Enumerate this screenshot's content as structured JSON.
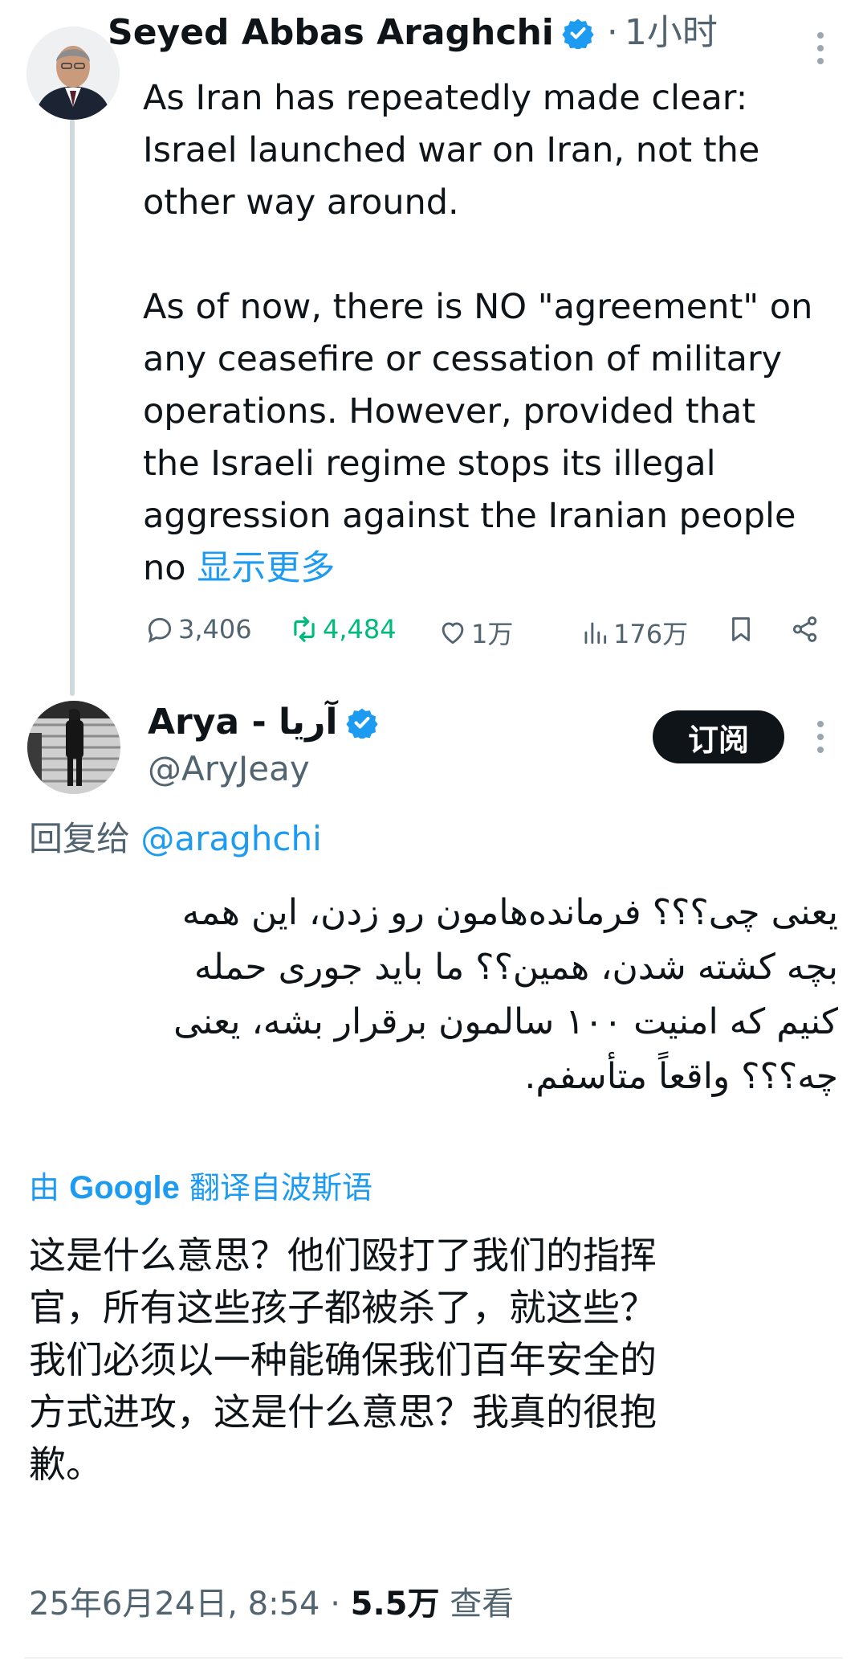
{
  "tweet1": {
    "author_name": "Seyed Abbas Araghchi",
    "time_sep": "·",
    "time": "1小时",
    "text": "As Iran has repeatedly made clear:\nIsrael launched war on Iran, not the\nother way around.\n\nAs of now, there is NO \"agreement\" on\nany ceasefire or cessation of military\noperations. However, provided that\nthe Israeli regime stops its illegal\naggression against the Iranian people\nno ",
    "show_more": "显示更多",
    "replies": "3,406",
    "retweets": "4,484",
    "likes": "1万",
    "views": "176万"
  },
  "tweet2": {
    "author_name": "Arya - آریا",
    "handle": "@AryJeay",
    "subscribe_label": "订阅",
    "reply_to_prefix": "回复给 ",
    "reply_to_handle": "@araghchi",
    "text": "یعنی چی؟؟؟ فرمانده‌هامون رو زدن، این همه\nبچه کشته شدن، همین؟؟ ما باید جوری حمله\nکنیم که امنیت ۱۰۰ سالمون برقرار بشه، یعنی\nچه؟؟؟ واقعاً متأسفم.",
    "translated_by_prefix": "由",
    "translated_by_brand": "Google",
    "translated_from": "翻译自波斯语",
    "translation": "这是什么意思？他们殴打了我们的指挥\n官，所有这些孩子都被杀了，就这些？\n我们必须以一种能确保我们百年安全的\n方式进攻，这是什么意思？我真的很抱\n歉。",
    "timestamp": "25年6月24日, 8:54",
    "meta_sep": "·",
    "view_count": "5.5万",
    "view_label": "查看"
  },
  "colors": {
    "accent": "#1d9bf0",
    "retweet": "#00ba7c",
    "muted": "#536471",
    "text": "#0f1419"
  },
  "icons": {
    "verified": "verified-badge-icon",
    "reply": "reply-icon",
    "retweet": "retweet-icon",
    "like": "heart-icon",
    "views": "bar-chart-icon",
    "bookmark": "bookmark-icon",
    "share": "share-icon",
    "more": "more-vertical-icon"
  }
}
